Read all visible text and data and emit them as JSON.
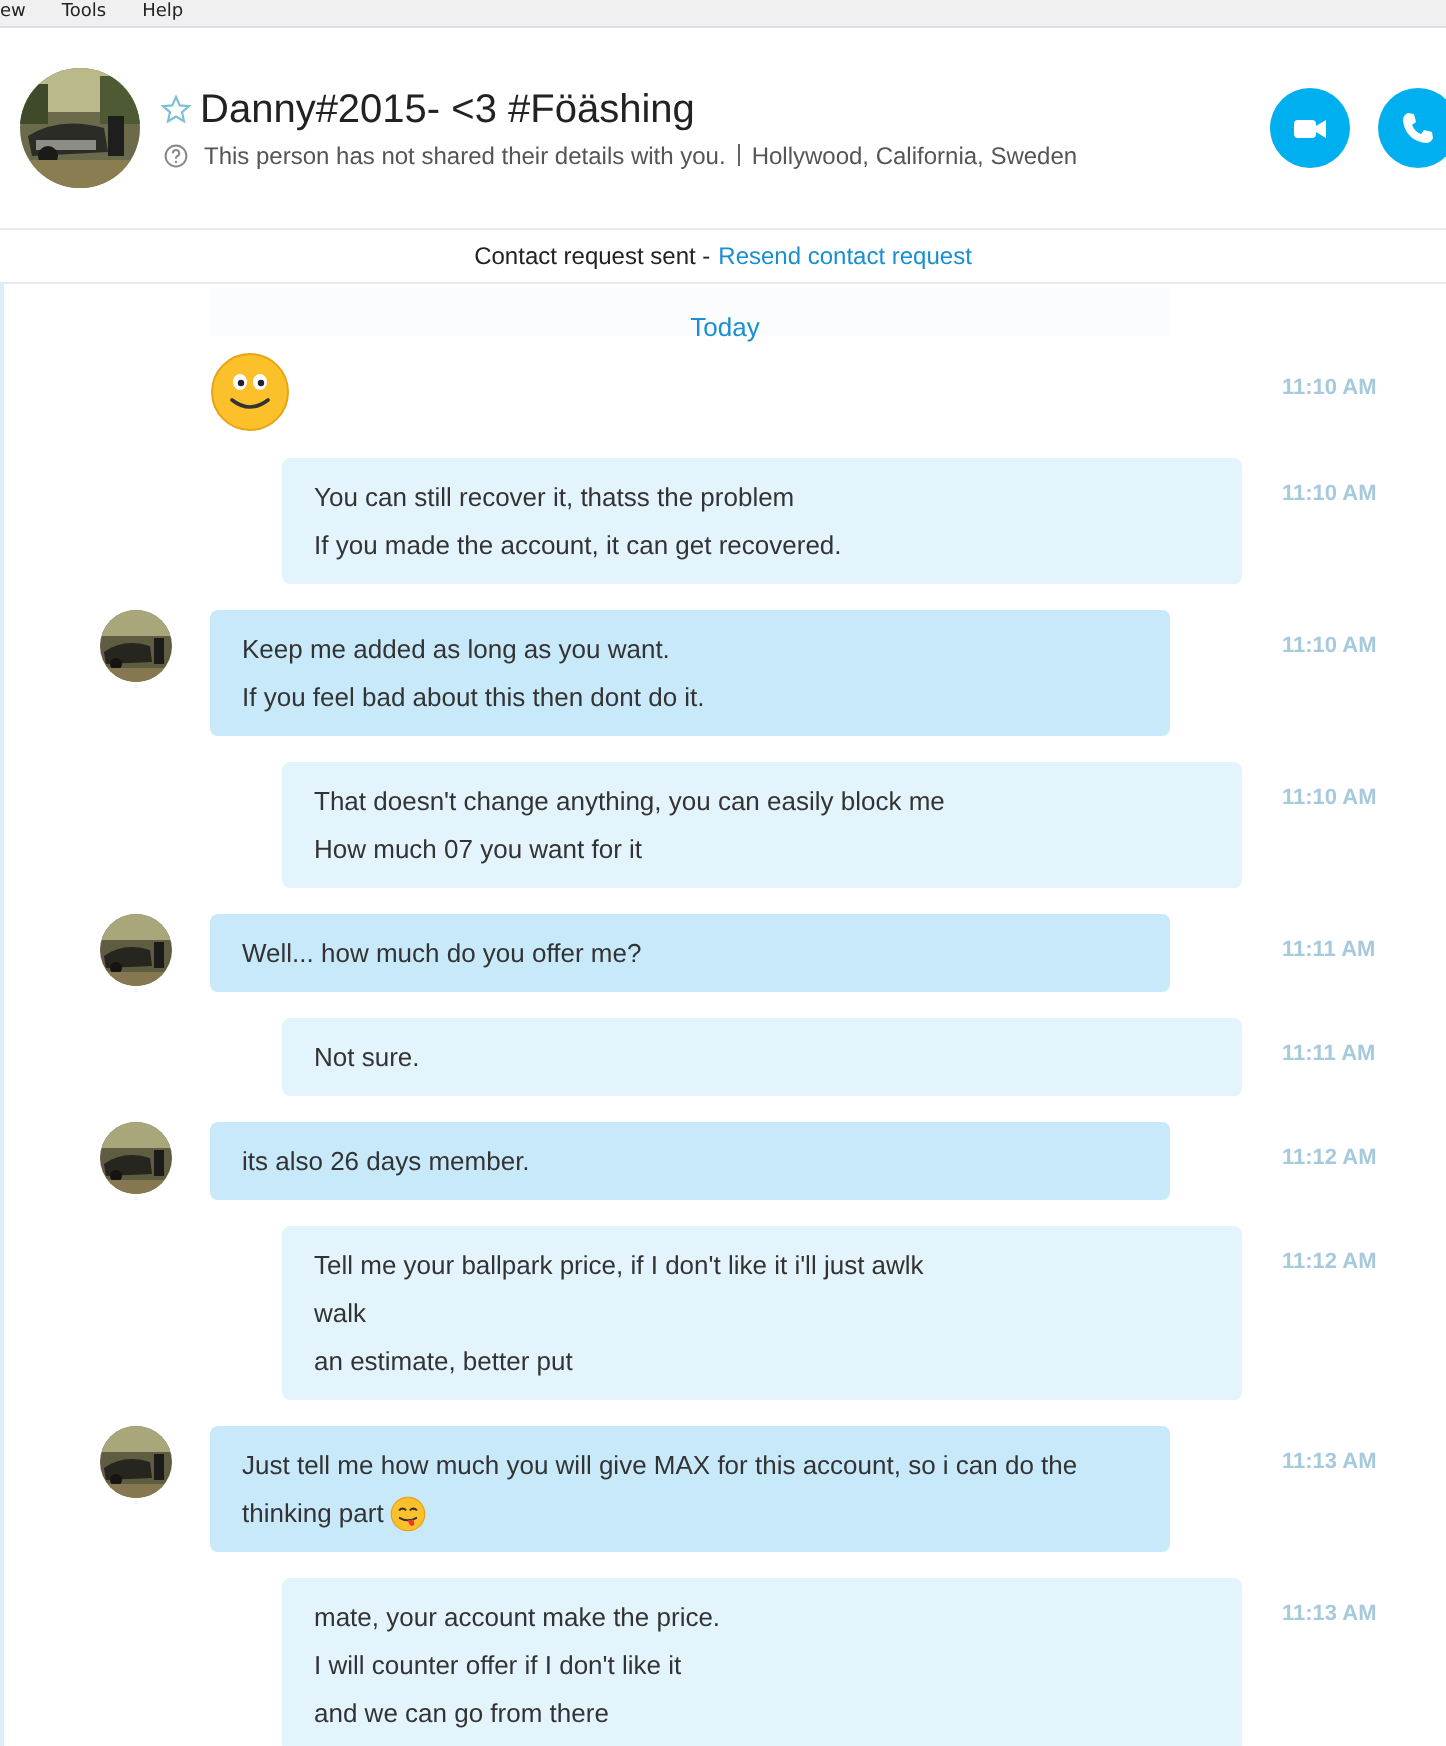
{
  "menu": [
    "ew",
    "Tools",
    "Help"
  ],
  "contact": {
    "name": "Danny#2015- <3 #Föäshing",
    "favorite": false,
    "details": "This person has not shared their details with you.",
    "location": "Hollywood, California, Sweden"
  },
  "call_buttons": [
    {
      "kind": "video"
    },
    {
      "kind": "audio"
    }
  ],
  "notice": {
    "text": "Contact request sent -",
    "link": "Resend contact request"
  },
  "day_label": "Today",
  "messages": [
    {
      "kind": "incoming-emoticon",
      "time": "11:10 AM"
    },
    {
      "kind": "outgoing",
      "lines": [
        "You can still recover it, thatss the problem",
        "If you made the account, it can get recovered."
      ],
      "time": "11:10 AM"
    },
    {
      "kind": "incoming",
      "lines": [
        "Keep me added as long as you want.",
        "If you feel bad about this then dont do it."
      ],
      "time": "11:10 AM"
    },
    {
      "kind": "outgoing",
      "lines": [
        "That doesn't change anything, you can easily block me",
        "How much 07 you want for it"
      ],
      "time": "11:10 AM"
    },
    {
      "kind": "incoming",
      "lines": [
        "Well... how much do you offer me?"
      ],
      "time": "11:11 AM"
    },
    {
      "kind": "outgoing",
      "lines": [
        "Not sure."
      ],
      "time": "11:11 AM"
    },
    {
      "kind": "incoming",
      "lines": [
        "its also 26 days member."
      ],
      "time": "11:12 AM"
    },
    {
      "kind": "outgoing",
      "lines": [
        "Tell me your ballpark price, if I don't like it i'll just awlk",
        "walk",
        "an estimate, better put"
      ],
      "time": "11:12 AM"
    },
    {
      "kind": "incoming",
      "lines": [
        "Just tell me how much you will give MAX for this account, so i can do the",
        "thinking part"
      ],
      "trailing_emoticon": true,
      "time": "11:13 AM"
    },
    {
      "kind": "outgoing",
      "lines": [
        "mate, your account make the price.",
        "I will counter offer if I don't like it",
        "and we can go from there"
      ],
      "time": "11:13 AM"
    }
  ]
}
